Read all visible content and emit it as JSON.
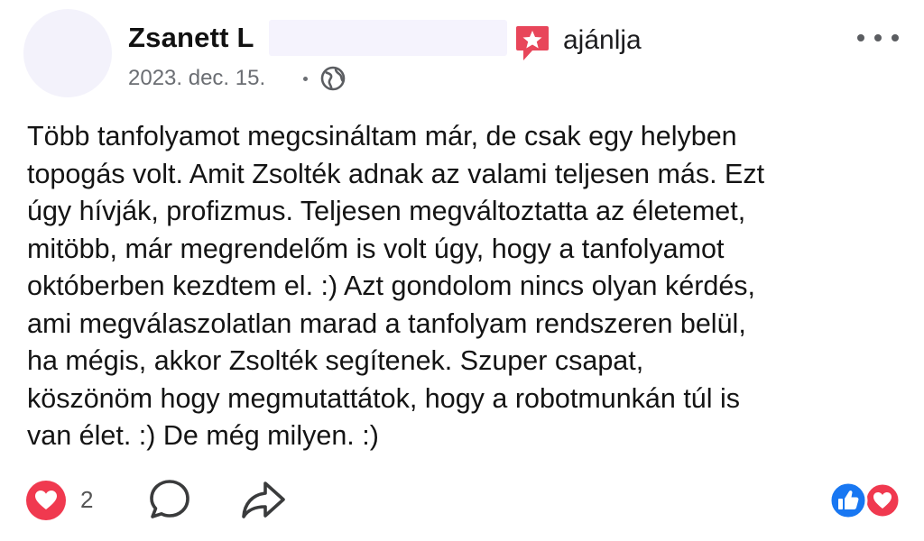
{
  "post": {
    "author_name": "Zsanett L",
    "recommends_label": "ajánlja",
    "date": "2023. dec. 15.",
    "privacy_icon": "globe-icon",
    "recommend_icon": "recommend-star-icon",
    "text": "Több tanfolyamot megcsináltam már, de csak egy helyben\ntopogás volt. Amit Zsolték adnak az valami teljesen más. Ezt\núgy hívják, profizmus. Teljesen megváltoztatta az életemet,\nmitöbb, már megrendelőm is volt úgy, hogy a tanfolyamot\noktóberben kezdtem el. :) Azt gondolom nincs olyan kérdés,\nami megválaszolatlan marad a tanfolyam rendszeren belül,\nha mégis, akkor Zsolték segítenek. Szuper csapat,\nköszönöm hogy megmutattátok, hogy a robotmunkán túl is\nvan élet. :) De még milyen. :)"
  },
  "footer": {
    "reaction_count": "2",
    "icons": [
      "heart-reaction-icon",
      "comment-icon",
      "share-icon",
      "like-reaction-icon",
      "love-reaction-icon"
    ]
  },
  "colors": {
    "recommend_red": "#e8465a",
    "heart_red": "#f0394f",
    "like_blue": "#1877f2",
    "meta_gray": "#6b6e73"
  }
}
